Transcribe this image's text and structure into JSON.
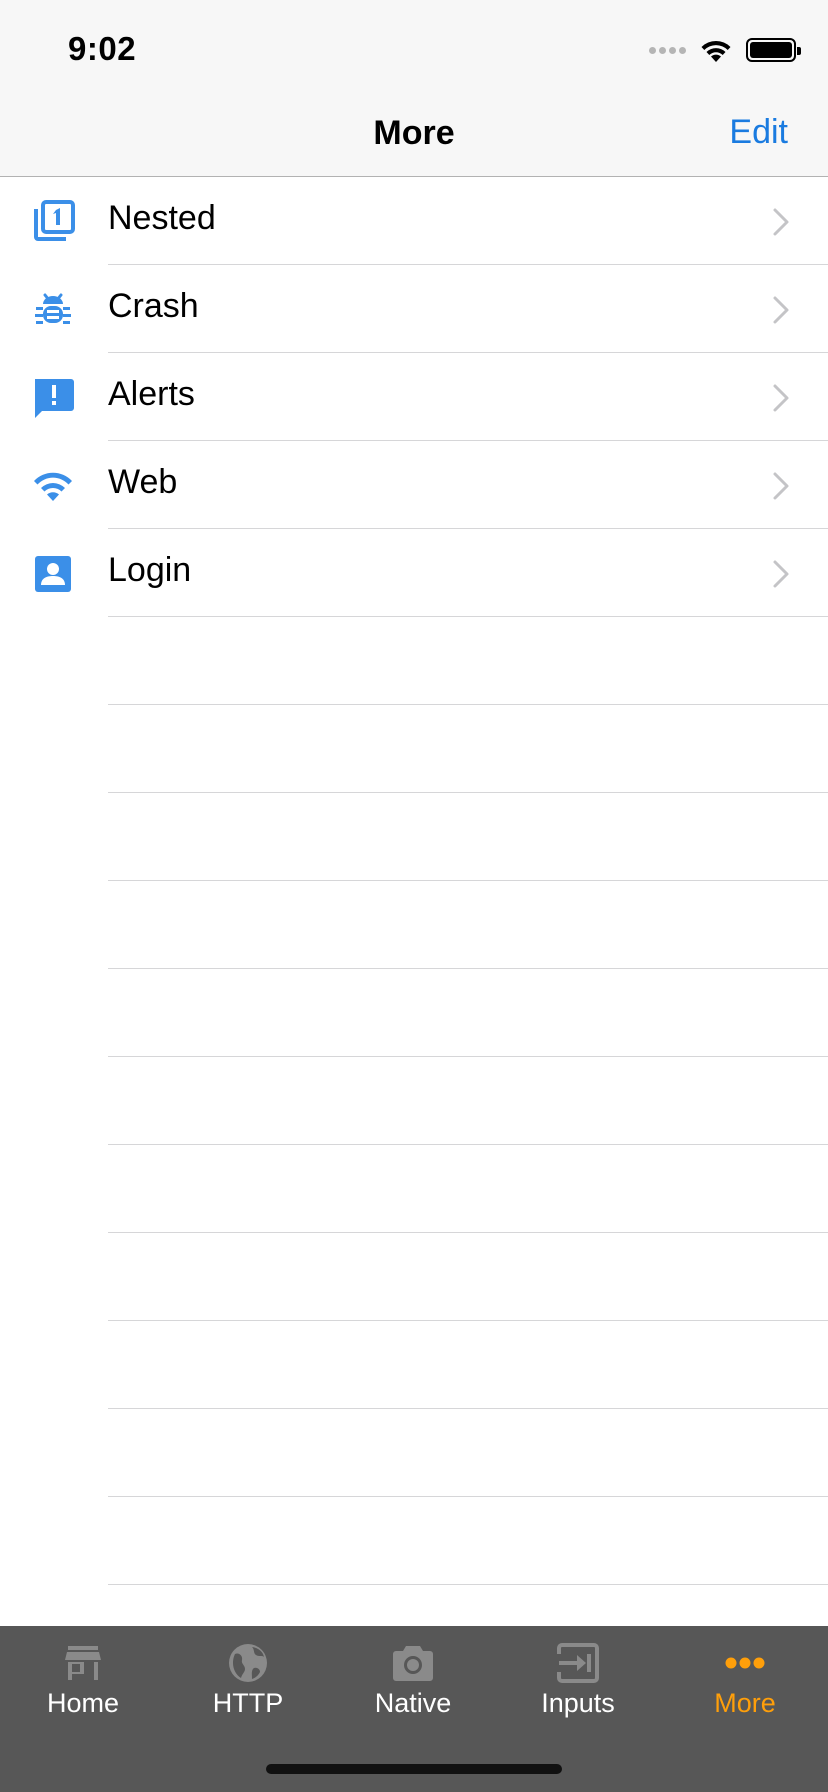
{
  "status_bar": {
    "time": "9:02"
  },
  "nav": {
    "title": "More",
    "edit_label": "Edit"
  },
  "list": {
    "items": [
      {
        "label": "Nested",
        "icon": "nested-one-icon"
      },
      {
        "label": "Crash",
        "icon": "bug-icon"
      },
      {
        "label": "Alerts",
        "icon": "alert-message-icon"
      },
      {
        "label": "Web",
        "icon": "wifi-icon"
      },
      {
        "label": "Login",
        "icon": "account-box-icon"
      }
    ]
  },
  "tabs": [
    {
      "label": "Home",
      "icon": "store-icon",
      "active": false
    },
    {
      "label": "HTTP",
      "icon": "globe-icon",
      "active": false
    },
    {
      "label": "Native",
      "icon": "camera-icon",
      "active": false
    },
    {
      "label": "Inputs",
      "icon": "input-icon",
      "active": false
    },
    {
      "label": "More",
      "icon": "more-dots-icon",
      "active": true
    }
  ],
  "colors": {
    "accent": "#1a7be0",
    "icon_blue": "#3b8fe8",
    "tab_active": "#ff9f0a",
    "tab_bar_bg": "#575757",
    "chevron": "#c4c4c7"
  }
}
